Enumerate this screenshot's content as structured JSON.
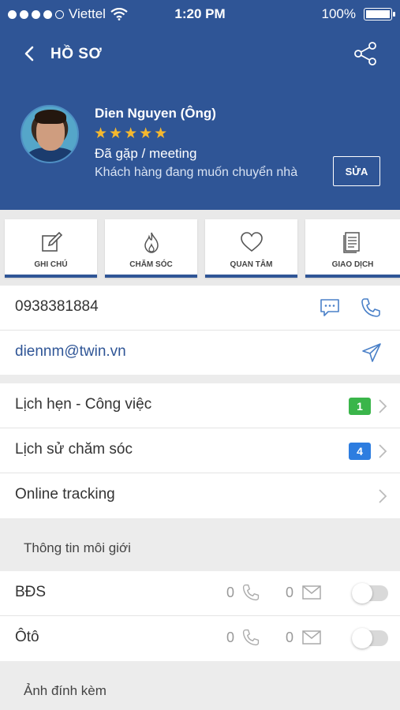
{
  "status_bar": {
    "carrier": "Viettel",
    "time": "1:20 PM",
    "battery": "100%",
    "signal_dots_filled": 4,
    "signal_dots_total": 5
  },
  "header": {
    "title": "HỒ SƠ"
  },
  "profile": {
    "name": "Dien Nguyen (Ông)",
    "rating": 5,
    "stars": "★★★★★",
    "status": "Đã gặp / meeting",
    "description": "Khách hàng đang muốn chuyển nhà",
    "edit_label": "SỬA"
  },
  "actions": [
    {
      "label": "GHI CHÚ",
      "icon": "edit-note-icon"
    },
    {
      "label": "CHĂM SÓC",
      "icon": "flame-icon"
    },
    {
      "label": "QUAN TÂM",
      "icon": "heart-icon"
    },
    {
      "label": "GIAO DỊCH",
      "icon": "document-icon"
    }
  ],
  "contact": {
    "phone": "0938381884",
    "email": "diennm@twin.vn"
  },
  "menu": [
    {
      "label": "Lịch hẹn - Công việc",
      "badge": "1",
      "badge_color": "#3ab54a"
    },
    {
      "label": "Lịch sử chăm sóc",
      "badge": "4",
      "badge_color": "#2d7de0"
    },
    {
      "label": "Online tracking"
    }
  ],
  "broker_section": {
    "title": "Thông tin môi giới",
    "rows": [
      {
        "label": "BĐS",
        "calls": "0",
        "messages": "0",
        "enabled": false
      },
      {
        "label": "Ôtô",
        "calls": "0",
        "messages": "0",
        "enabled": false
      }
    ]
  },
  "attachments_section": {
    "title": "Ảnh đính kèm"
  },
  "colors": {
    "primary": "#2f5596",
    "star": "#f5b82e",
    "icon_blue": "#4a80c8"
  }
}
